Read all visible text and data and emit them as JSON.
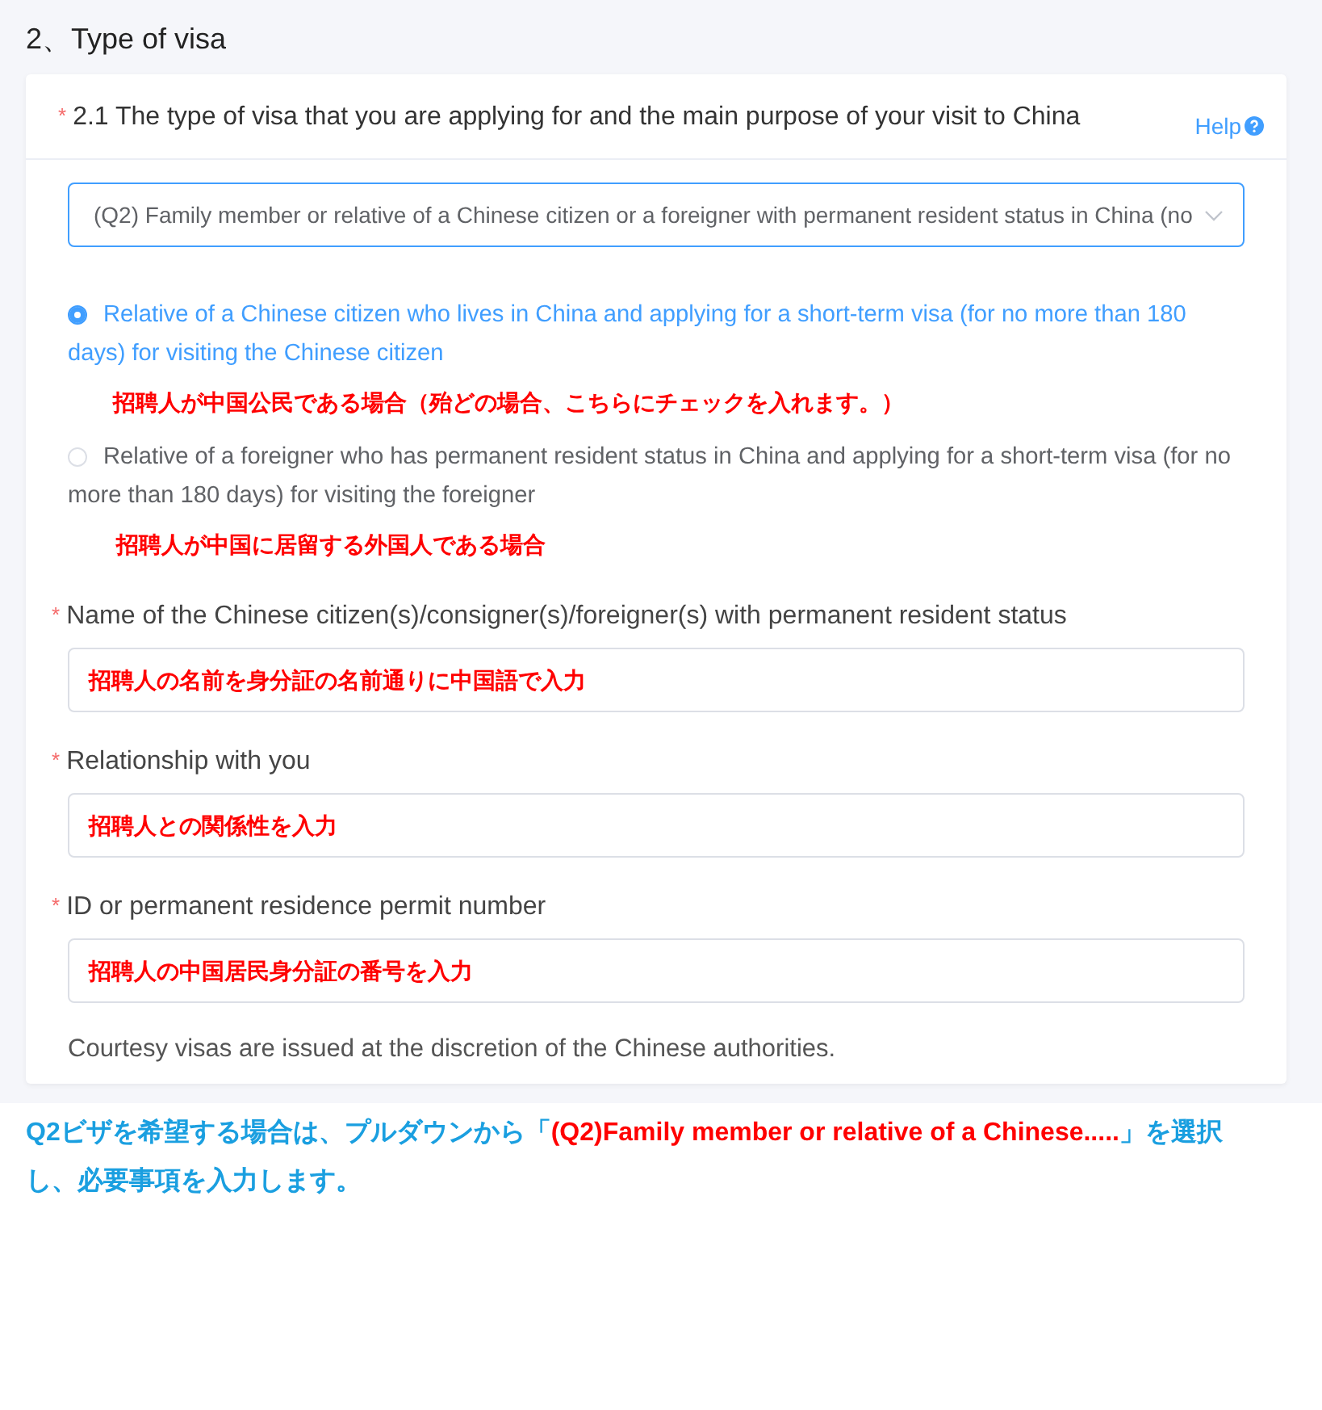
{
  "section_title": "2、Type of visa",
  "question": {
    "required_mark": "*",
    "label": "2.1 The type of visa that you are applying for and the main purpose of your visit to China",
    "help": "Help"
  },
  "visa_select": {
    "value": "(Q2) Family member or relative of a Chinese citizen or a foreigner with permanent resident status in China (no"
  },
  "options": [
    {
      "label": "Relative of a Chinese citizen who lives in China and applying for a short-term visa (for no more than 180 days) for visiting the Chinese citizen",
      "selected": true,
      "note": "招聘人が中国公民である場合（殆どの場合、こちらにチェックを入れます。）"
    },
    {
      "label": "Relative of a foreigner who has permanent resident status in China and applying for a short-term visa (for no more than 180 days) for visiting the foreigner",
      "selected": false,
      "note": "招聘人が中国に居留する外国人である場合"
    }
  ],
  "fields": [
    {
      "label": "Name of the Chinese citizen(s)/consigner(s)/foreigner(s) with permanent resident status",
      "required_mark": "*",
      "value": "招聘人の名前を身分証の名前通りに中国語で入力"
    },
    {
      "label": "Relationship with you",
      "required_mark": "*",
      "value": "招聘人との関係性を入力"
    },
    {
      "label": "ID or permanent residence permit number",
      "required_mark": "*",
      "value": "招聘人の中国居民身分証の番号を入力"
    }
  ],
  "notice": "Courtesy visas are issued at the discretion of the Chinese authorities.",
  "caption": [
    {
      "text": "Q2ビザを希望する場合は、プルダウンから「",
      "highlight": false
    },
    {
      "text": "(Q2)Family member or relative of a Chinese.....",
      "highlight": true
    },
    {
      "text": "」を選択し、必要事項を入力します。",
      "highlight": false
    }
  ]
}
